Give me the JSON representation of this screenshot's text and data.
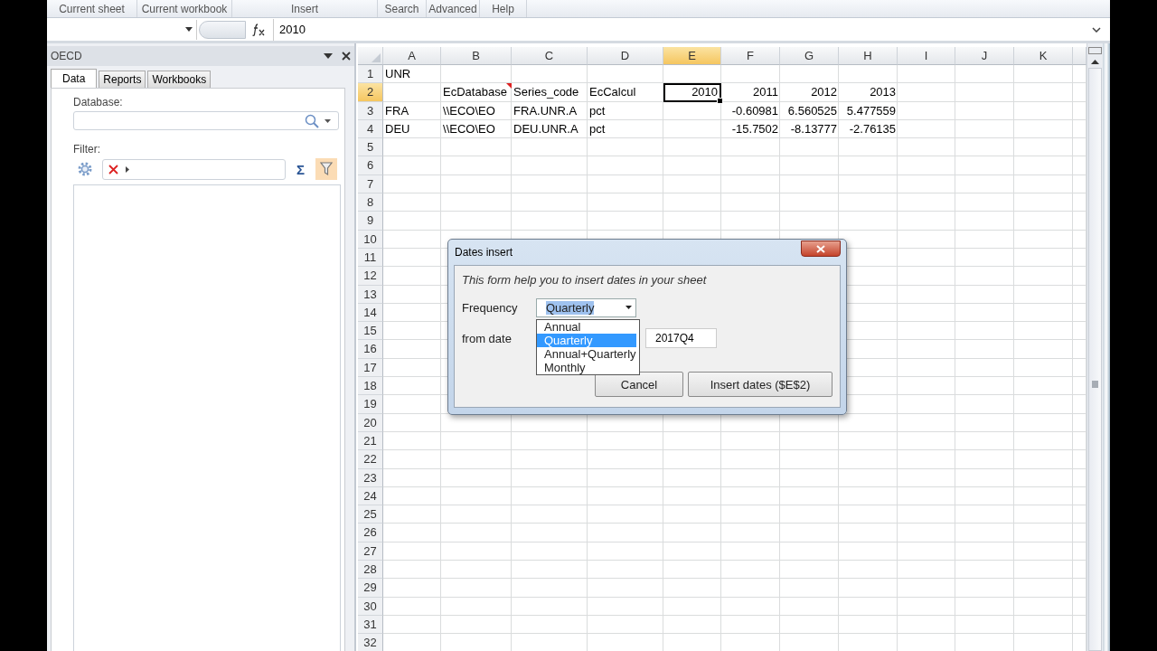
{
  "ribbon": {
    "groups": [
      "Current sheet",
      "Current workbook",
      "Insert",
      "Search",
      "Advanced",
      "Help"
    ]
  },
  "formula_bar": {
    "value": "2010"
  },
  "pane": {
    "title": "OECD",
    "tabs": [
      {
        "label": "Data",
        "selected": true
      },
      {
        "label": "Reports",
        "selected": false
      },
      {
        "label": "Workbooks",
        "selected": false
      }
    ],
    "database_label": "Database:",
    "filter_label": "Filter:",
    "sigma": "Σ",
    "filter_active": true
  },
  "sheet": {
    "columns": [
      {
        "label": "A",
        "selected": false
      },
      {
        "label": "B",
        "selected": false
      },
      {
        "label": "C",
        "selected": false
      },
      {
        "label": "D",
        "selected": false
      },
      {
        "label": "E",
        "selected": true
      },
      {
        "label": "F",
        "selected": false
      },
      {
        "label": "G",
        "selected": false
      },
      {
        "label": "H",
        "selected": false
      },
      {
        "label": "I",
        "selected": false
      },
      {
        "label": "J",
        "selected": false
      },
      {
        "label": "K",
        "selected": false
      }
    ],
    "rows": [
      {
        "number": "1",
        "selected": false,
        "cells": [
          {
            "text": "UNR",
            "kind": "text",
            "selected": false,
            "comment": false
          }
        ]
      },
      {
        "number": "2",
        "selected": true,
        "cells": [
          null,
          {
            "text": "EcDatabase",
            "kind": "text",
            "selected": false,
            "comment": true
          },
          {
            "text": "Series_code",
            "kind": "text",
            "selected": false,
            "comment": false
          },
          {
            "text": "EcCalcul",
            "kind": "text",
            "selected": false,
            "comment": false
          },
          {
            "text": "2010",
            "kind": "number",
            "selected": true,
            "comment": false
          },
          {
            "text": "2011",
            "kind": "number",
            "selected": false,
            "comment": false
          },
          {
            "text": "2012",
            "kind": "number",
            "selected": false,
            "comment": false
          },
          {
            "text": "2013",
            "kind": "number",
            "selected": false,
            "comment": false
          }
        ]
      },
      {
        "number": "3",
        "selected": false,
        "cells": [
          {
            "text": "FRA",
            "kind": "text",
            "selected": false,
            "comment": false
          },
          {
            "text": "\\\\ECO\\EO",
            "kind": "text",
            "selected": false,
            "comment": false
          },
          {
            "text": "FRA.UNR.A",
            "kind": "text",
            "selected": false,
            "comment": false
          },
          {
            "text": "pct",
            "kind": "text",
            "selected": false,
            "comment": false
          },
          null,
          {
            "text": "-0.60981",
            "kind": "number",
            "selected": false,
            "comment": false
          },
          {
            "text": "6.560525",
            "kind": "number",
            "selected": false,
            "comment": false
          },
          {
            "text": "5.477559",
            "kind": "number",
            "selected": false,
            "comment": false
          }
        ]
      },
      {
        "number": "4",
        "selected": false,
        "cells": [
          {
            "text": "DEU",
            "kind": "text",
            "selected": false,
            "comment": false
          },
          {
            "text": "\\\\ECO\\EO",
            "kind": "text",
            "selected": false,
            "comment": false
          },
          {
            "text": "DEU.UNR.A",
            "kind": "text",
            "selected": false,
            "comment": false
          },
          {
            "text": "pct",
            "kind": "text",
            "selected": false,
            "comment": false
          },
          null,
          {
            "text": "-15.7502",
            "kind": "number",
            "selected": false,
            "comment": false
          },
          {
            "text": "-8.13777",
            "kind": "number",
            "selected": false,
            "comment": false
          },
          {
            "text": "-2.76135",
            "kind": "number",
            "selected": false,
            "comment": false
          }
        ]
      },
      {
        "number": "5",
        "selected": false
      },
      {
        "number": "6",
        "selected": false
      },
      {
        "number": "7",
        "selected": false
      },
      {
        "number": "8",
        "selected": false
      },
      {
        "number": "9",
        "selected": false
      },
      {
        "number": "10",
        "selected": false
      },
      {
        "number": "11",
        "selected": false
      },
      {
        "number": "12",
        "selected": false
      },
      {
        "number": "13",
        "selected": false
      },
      {
        "number": "14",
        "selected": false
      },
      {
        "number": "15",
        "selected": false
      },
      {
        "number": "16",
        "selected": false
      },
      {
        "number": "17",
        "selected": false
      },
      {
        "number": "18",
        "selected": false
      },
      {
        "number": "19",
        "selected": false
      },
      {
        "number": "20",
        "selected": false
      },
      {
        "number": "21",
        "selected": false
      },
      {
        "number": "22",
        "selected": false
      },
      {
        "number": "23",
        "selected": false
      },
      {
        "number": "24",
        "selected": false
      },
      {
        "number": "25",
        "selected": false
      },
      {
        "number": "26",
        "selected": false
      },
      {
        "number": "27",
        "selected": false
      },
      {
        "number": "28",
        "selected": false
      },
      {
        "number": "29",
        "selected": false
      },
      {
        "number": "30",
        "selected": false
      },
      {
        "number": "31",
        "selected": false
      },
      {
        "number": "32",
        "selected": false
      }
    ]
  },
  "dialog": {
    "title": "Dates insert",
    "intro": "This form help you to insert dates in your sheet",
    "frequency": {
      "label": "Frequency",
      "value": "Quarterly",
      "expanded": true,
      "options": [
        {
          "label": "Annual",
          "selected": false
        },
        {
          "label": "Quarterly",
          "selected": true
        },
        {
          "label": "Annual+Quarterly",
          "selected": false
        },
        {
          "label": "Monthly",
          "selected": false
        }
      ]
    },
    "from_date": {
      "label": "from date",
      "value": "2017Q4"
    },
    "buttons": [
      "Cancel",
      "Insert dates ($E$2)"
    ]
  }
}
